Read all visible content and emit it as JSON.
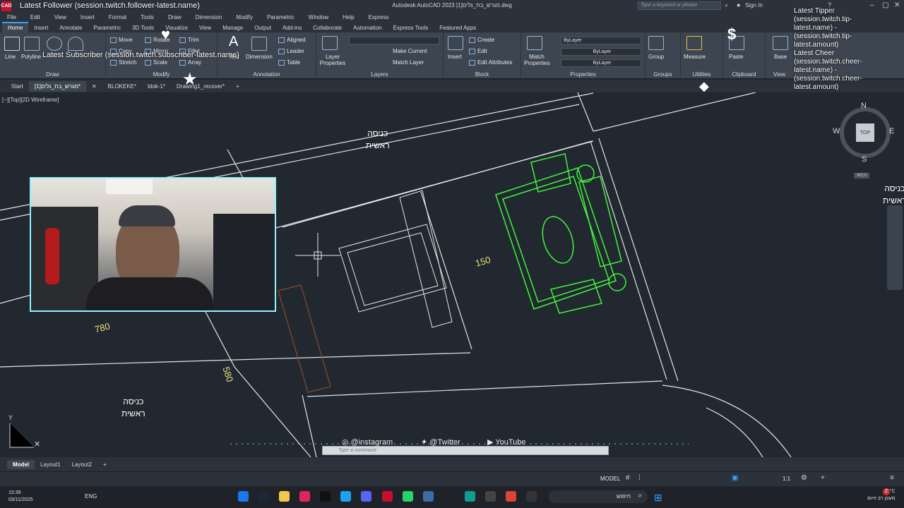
{
  "titlebar": {
    "app_badge": "CAD",
    "title": "Autodesk AutoCAD 2023    מגרש_בת_גלים[1].dwg",
    "search_placeholder": "Type a keyword or phrase",
    "sign_in": "Sign In"
  },
  "menubar": {
    "items": [
      "File",
      "Edit",
      "View",
      "Insert",
      "Format",
      "Tools",
      "Draw",
      "Dimension",
      "Modify",
      "Parametric",
      "Window",
      "Help",
      "Express"
    ]
  },
  "ribbon_tabs": [
    "Home",
    "Insert",
    "Annotate",
    "Parametric",
    "3D Tools",
    "Visualize",
    "View",
    "Manage",
    "Output",
    "Add-ins",
    "Collaborate",
    "Automation",
    "Express Tools",
    "Featured Apps"
  ],
  "ribbon": {
    "draw": {
      "title": "Draw",
      "line": "Line",
      "polyline": "Polyline"
    },
    "modify": {
      "title": "Modify",
      "move": "Move",
      "copy": "Copy",
      "rotate": "Rotate",
      "mirror": "Mirror",
      "stretch": "Stretch",
      "scale": "Scale",
      "trim": "Trim",
      "fillet": "Fillet",
      "array": "Array"
    },
    "annotation": {
      "title": "Annotation",
      "text": "Text",
      "dimension": "Dimension",
      "leader": "Leader",
      "table": "Table",
      "aligned": "Aligned"
    },
    "layers": {
      "title": "Layers",
      "layer_properties": "Layer Properties",
      "make_current": "Make Current",
      "match_layer": "Match Layer"
    },
    "block": {
      "title": "Block",
      "insert": "Insert",
      "create": "Create",
      "edit": "Edit",
      "edit_attributes": "Edit Attributes"
    },
    "properties": {
      "title": "Properties",
      "match_properties": "Match Properties",
      "bylayer1": "ByLayer",
      "bylayer2": "ByLayer",
      "bylayer3": "ByLayer"
    },
    "groups": {
      "title": "Groups",
      "group": "Group"
    },
    "utilities": {
      "title": "Utilities",
      "measure": "Measure"
    },
    "clipboard": {
      "title": "Clipboard",
      "paste": "Paste"
    },
    "view": {
      "title": "View",
      "base": "Base"
    }
  },
  "doc_tabs": [
    "Start",
    "מגרש_בת_גלים[1]*",
    "BLOKEKE*",
    "blok-1*",
    "Drawing1_recover*"
  ],
  "viewport": {
    "label": "[−][Top][2D Wireframe]"
  },
  "drawing": {
    "entrance_line1": "כניסה",
    "entrance_line2": "ראשית",
    "dim_150": "150",
    "dim_780": "780",
    "dim_580": "580",
    "y_axis": "Y"
  },
  "overlay": {
    "follower": "Latest Follower (session.twitch.follower-latest.name)",
    "subscriber": "Latest Subscriber (session.twitch.subscriber-latest.name)",
    "tipper_title": "Latest Tipper",
    "tipper_lines": [
      "(session.twitch.tip-",
      "latest.name) -",
      "(session.twitch.tip-",
      "latest.amount)"
    ],
    "cheer_title": "Latest Cheer",
    "cheer_lines": [
      "(session.twitch.cheer-",
      "latest.name) -",
      "(session.twitch.cheer-",
      "latest.amount)"
    ],
    "instagram": "@instagram",
    "twitter": "@Twitter",
    "youtube": "YouTube"
  },
  "command_line": {
    "placeholder": "Type a command"
  },
  "viewcube": {
    "n": "N",
    "s": "S",
    "e": "E",
    "w": "W",
    "top": "TOP",
    "wcs": "WCS"
  },
  "layout_tabs": [
    "Model",
    "Layout1",
    "Layout2"
  ],
  "statusbar": {
    "model": "MODEL",
    "scale": "1:1"
  },
  "taskbar": {
    "time": "15:39",
    "date": "03/11/2025",
    "lang": "ENG",
    "search_label": "חיפוש",
    "weather": "28°C",
    "weather_desc": "מעונן רב היום",
    "notification_count": "2"
  },
  "colors": {
    "canvas": "#212830",
    "line": "#e6e6e6",
    "furniture": "#44f23c",
    "dim": "#e8e27a",
    "brown": "#8a4b2c"
  }
}
